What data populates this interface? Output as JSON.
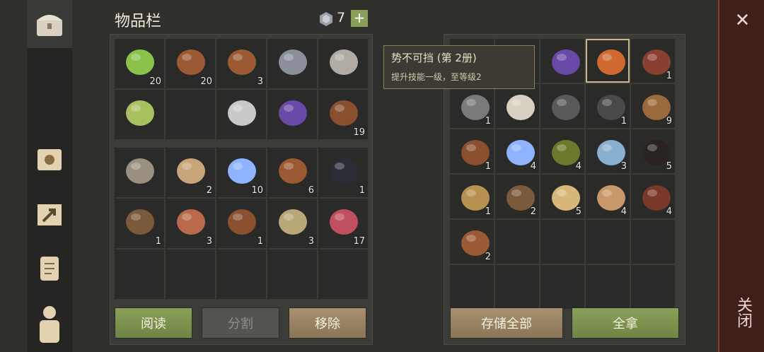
{
  "header": {
    "title": "物品栏",
    "gem_count": "7",
    "add_symbol": "+"
  },
  "tooltip": {
    "title": "势不可挡 (第 2册)",
    "desc": "提升技能一级，至等级2"
  },
  "left_tabs": [
    {
      "name": "chest-icon",
      "active": true
    },
    {
      "name": "sun-book-icon",
      "active": false
    },
    {
      "name": "arrow-map-icon",
      "active": false
    },
    {
      "name": "scroll-icon",
      "active": false
    },
    {
      "name": "character-icon",
      "active": false
    }
  ],
  "inventory_grid1": [
    {
      "icon": "seaweed-icon",
      "color": "#8bc34a",
      "count": "20"
    },
    {
      "icon": "barrel-icon",
      "color": "#9b5a34",
      "count": "20"
    },
    {
      "icon": "barrel-icon",
      "color": "#9b5a34",
      "count": "3"
    },
    {
      "icon": "viking-helmet-icon",
      "color": "#8a8f9a",
      "count": ""
    },
    {
      "icon": "pickaxe-icon",
      "color": "#b0aca5",
      "count": ""
    },
    {
      "icon": "dagger-icon",
      "color": "#a8c060",
      "count": ""
    },
    {
      "icon": "",
      "color": "",
      "count": ""
    },
    {
      "icon": "sword-icon",
      "color": "#c9c9c9",
      "count": ""
    },
    {
      "icon": "purple-book-icon",
      "color": "#6a4aa8",
      "count": ""
    },
    {
      "icon": "leather-icon",
      "color": "#8a4f2e",
      "count": "19"
    }
  ],
  "inventory_grid2": [
    {
      "icon": "halberd-icon",
      "color": "#9a9080",
      "count": ""
    },
    {
      "icon": "red-scroll-icon",
      "color": "#c9a67a",
      "count": "2"
    },
    {
      "icon": "crystal-icon",
      "color": "#8fb4ff",
      "count": "10"
    },
    {
      "icon": "barrel-icon",
      "color": "#9b5a34",
      "count": "6"
    },
    {
      "icon": "coal-icon",
      "color": "#2a2c36",
      "count": "1"
    },
    {
      "icon": "trap-icon",
      "color": "#7a5a3a",
      "count": "1"
    },
    {
      "icon": "hourglass-icon",
      "color": "#b96a4a",
      "count": "3"
    },
    {
      "icon": "bottle-icon",
      "color": "#8a5030",
      "count": "1"
    },
    {
      "icon": "powder-icon",
      "color": "#b8a878",
      "count": "3"
    },
    {
      "icon": "berry-bowl-icon",
      "color": "#c05060",
      "count": "17"
    },
    {
      "icon": "",
      "color": "",
      "count": ""
    },
    {
      "icon": "",
      "color": "",
      "count": ""
    },
    {
      "icon": "",
      "color": "",
      "count": ""
    },
    {
      "icon": "",
      "color": "",
      "count": ""
    },
    {
      "icon": "",
      "color": "",
      "count": ""
    }
  ],
  "storage_grid": [
    {
      "icon": "scroll-icon",
      "color": "#c9a67a",
      "count": ""
    },
    {
      "icon": "",
      "color": "",
      "count": ""
    },
    {
      "icon": "purple-book-icon",
      "color": "#6a4aa8",
      "count": ""
    },
    {
      "icon": "orange-book-icon",
      "color": "#d06a30",
      "count": "",
      "selected": true
    },
    {
      "icon": "collar-icon",
      "color": "#8a4030",
      "count": "1"
    },
    {
      "icon": "wrench-icon",
      "color": "#7a7a7a",
      "count": "1"
    },
    {
      "icon": "blueprint-icon",
      "color": "#d8d0c0",
      "count": ""
    },
    {
      "icon": "shield-icon",
      "color": "#5a5a5a",
      "count": ""
    },
    {
      "icon": "gear-icon",
      "color": "#4a4a4a",
      "count": "1"
    },
    {
      "icon": "grain-sack-icon",
      "color": "#9a6a3a",
      "count": "9"
    },
    {
      "icon": "bottle-icon",
      "color": "#8a5030",
      "count": "1"
    },
    {
      "icon": "crystal-icon",
      "color": "#8fb4ff",
      "count": "4"
    },
    {
      "icon": "herb-ball-icon",
      "color": "#6a7a2a",
      "count": "4"
    },
    {
      "icon": "potion-icon",
      "color": "#8ab0d0",
      "count": "3"
    },
    {
      "icon": "rope-icon",
      "color": "#2a2420",
      "count": "5"
    },
    {
      "icon": "goblet-icon",
      "color": "#b89050",
      "count": "1"
    },
    {
      "icon": "trap-icon",
      "color": "#7a5a3a",
      "count": "2"
    },
    {
      "icon": "candle-icon",
      "color": "#d8b878",
      "count": "5"
    },
    {
      "icon": "cloth-icon",
      "color": "#c89868",
      "count": "4"
    },
    {
      "icon": "mug-icon",
      "color": "#7a3a2a",
      "count": "4"
    },
    {
      "icon": "barrel-icon",
      "color": "#9b5a34",
      "count": "2"
    },
    {
      "icon": "",
      "color": "",
      "count": ""
    },
    {
      "icon": "",
      "color": "",
      "count": ""
    },
    {
      "icon": "",
      "color": "",
      "count": ""
    },
    {
      "icon": "",
      "color": "",
      "count": ""
    },
    {
      "icon": "",
      "color": "",
      "count": ""
    },
    {
      "icon": "",
      "color": "",
      "count": ""
    },
    {
      "icon": "",
      "color": "",
      "count": ""
    },
    {
      "icon": "",
      "color": "",
      "count": ""
    },
    {
      "icon": "",
      "color": "",
      "count": ""
    }
  ],
  "buttons": {
    "read": "阅读",
    "split": "分割",
    "remove": "移除",
    "store_all": "存储全部",
    "take_all": "全拿"
  },
  "close": {
    "x": "✕",
    "label": "关闭"
  },
  "colors": {
    "accent_green": "#8aa05a",
    "tan": "#a89070",
    "close_red": "#8c3a2c"
  }
}
